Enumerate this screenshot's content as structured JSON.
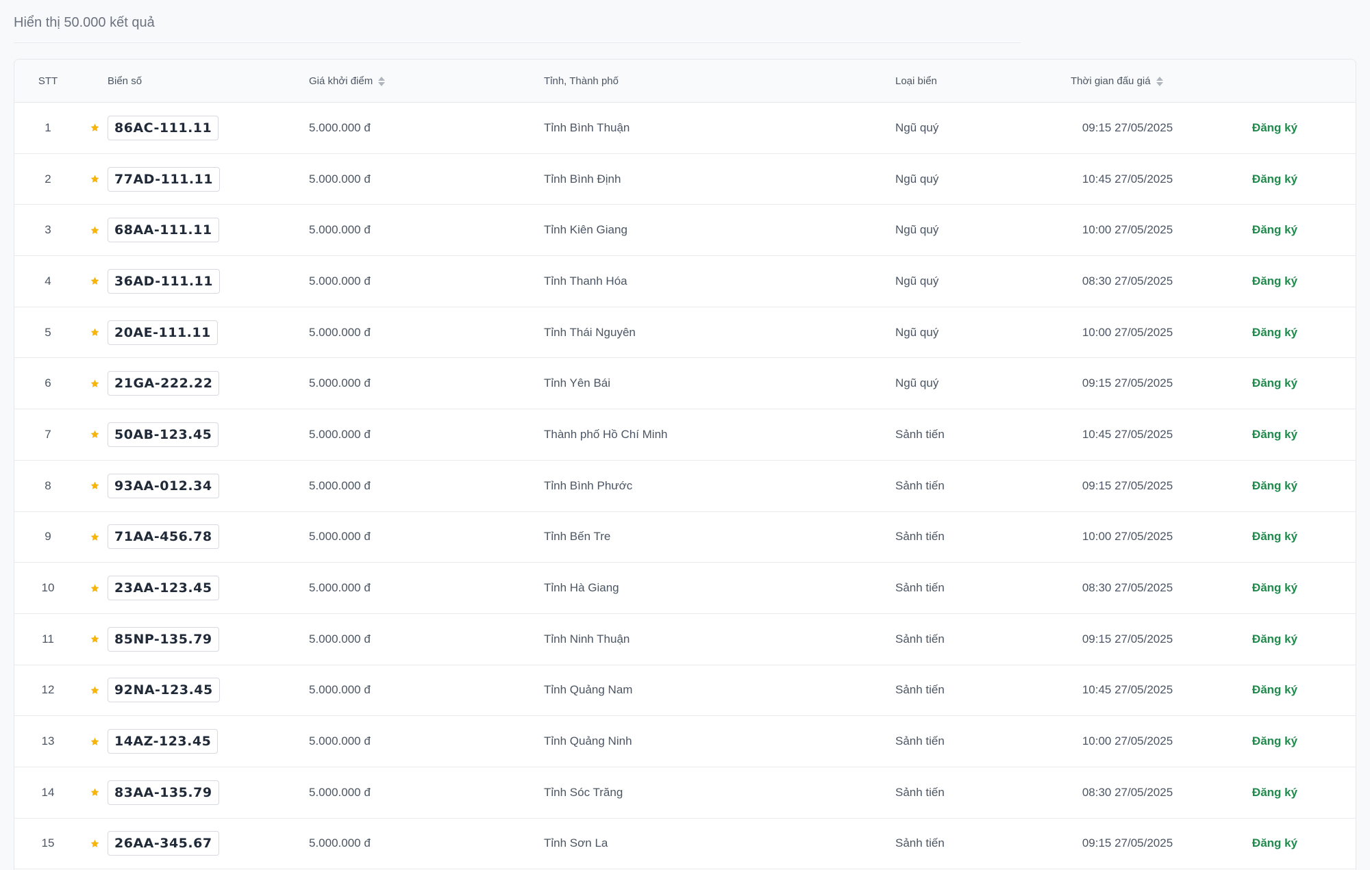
{
  "summary": "Hiển thị 50.000 kết quả",
  "headers": {
    "stt": "STT",
    "plate": "Biển số",
    "price": "Giá khởi điểm",
    "province": "Tỉnh, Thành phố",
    "type": "Loại biển",
    "time": "Thời gian đấu giá"
  },
  "icons": {
    "star": "star-icon",
    "sort": "sort-icon"
  },
  "colors": {
    "star": "#f5b50a",
    "action": "#1f8a4c"
  },
  "rows": [
    {
      "stt": "1",
      "plate": "86AC-111.11",
      "price": "5.000.000 đ",
      "province": "Tỉnh Bình Thuận",
      "type": "Ngũ quý",
      "time": "09:15 27/05/2025",
      "action": "Đăng ký"
    },
    {
      "stt": "2",
      "plate": "77AD-111.11",
      "price": "5.000.000 đ",
      "province": "Tỉnh Bình Định",
      "type": "Ngũ quý",
      "time": "10:45 27/05/2025",
      "action": "Đăng ký"
    },
    {
      "stt": "3",
      "plate": "68AA-111.11",
      "price": "5.000.000 đ",
      "province": "Tỉnh Kiên Giang",
      "type": "Ngũ quý",
      "time": "10:00 27/05/2025",
      "action": "Đăng ký"
    },
    {
      "stt": "4",
      "plate": "36AD-111.11",
      "price": "5.000.000 đ",
      "province": "Tỉnh Thanh Hóa",
      "type": "Ngũ quý",
      "time": "08:30 27/05/2025",
      "action": "Đăng ký"
    },
    {
      "stt": "5",
      "plate": "20AE-111.11",
      "price": "5.000.000 đ",
      "province": "Tỉnh Thái Nguyên",
      "type": "Ngũ quý",
      "time": "10:00 27/05/2025",
      "action": "Đăng ký"
    },
    {
      "stt": "6",
      "plate": "21GA-222.22",
      "price": "5.000.000 đ",
      "province": "Tỉnh Yên Bái",
      "type": "Ngũ quý",
      "time": "09:15 27/05/2025",
      "action": "Đăng ký"
    },
    {
      "stt": "7",
      "plate": "50AB-123.45",
      "price": "5.000.000 đ",
      "province": "Thành phố Hồ Chí Minh",
      "type": "Sảnh tiến",
      "time": "10:45 27/05/2025",
      "action": "Đăng ký"
    },
    {
      "stt": "8",
      "plate": "93AA-012.34",
      "price": "5.000.000 đ",
      "province": "Tỉnh Bình Phước",
      "type": "Sảnh tiến",
      "time": "09:15 27/05/2025",
      "action": "Đăng ký"
    },
    {
      "stt": "9",
      "plate": "71AA-456.78",
      "price": "5.000.000 đ",
      "province": "Tỉnh Bến Tre",
      "type": "Sảnh tiến",
      "time": "10:00 27/05/2025",
      "action": "Đăng ký"
    },
    {
      "stt": "10",
      "plate": "23AA-123.45",
      "price": "5.000.000 đ",
      "province": "Tỉnh Hà Giang",
      "type": "Sảnh tiến",
      "time": "08:30 27/05/2025",
      "action": "Đăng ký"
    },
    {
      "stt": "11",
      "plate": "85NP-135.79",
      "price": "5.000.000 đ",
      "province": "Tỉnh Ninh Thuận",
      "type": "Sảnh tiến",
      "time": "09:15 27/05/2025",
      "action": "Đăng ký"
    },
    {
      "stt": "12",
      "plate": "92NA-123.45",
      "price": "5.000.000 đ",
      "province": "Tỉnh Quảng Nam",
      "type": "Sảnh tiến",
      "time": "10:45 27/05/2025",
      "action": "Đăng ký"
    },
    {
      "stt": "13",
      "plate": "14AZ-123.45",
      "price": "5.000.000 đ",
      "province": "Tỉnh Quảng Ninh",
      "type": "Sảnh tiến",
      "time": "10:00 27/05/2025",
      "action": "Đăng ký"
    },
    {
      "stt": "14",
      "plate": "83AA-135.79",
      "price": "5.000.000 đ",
      "province": "Tỉnh Sóc Trăng",
      "type": "Sảnh tiến",
      "time": "08:30 27/05/2025",
      "action": "Đăng ký"
    },
    {
      "stt": "15",
      "plate": "26AA-345.67",
      "price": "5.000.000 đ",
      "province": "Tỉnh Sơn La",
      "type": "Sảnh tiến",
      "time": "09:15 27/05/2025",
      "action": "Đăng ký"
    }
  ]
}
